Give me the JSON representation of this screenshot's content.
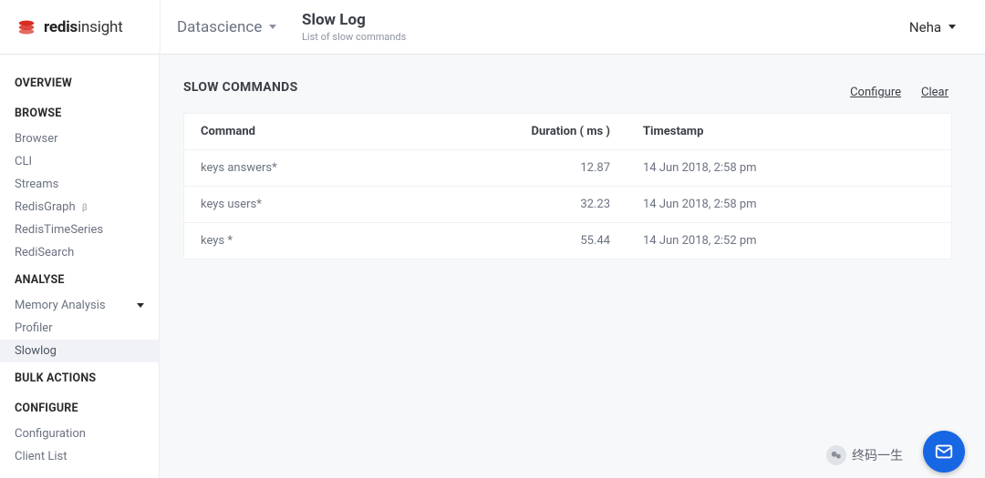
{
  "brand": {
    "bold": "redis",
    "light": "insight"
  },
  "dbSelector": {
    "name": "Datascience"
  },
  "page": {
    "title": "Slow Log",
    "subtitle": "List of slow commands"
  },
  "user": {
    "name": "Neha"
  },
  "sidebar": {
    "sections": [
      {
        "header": "OVERVIEW",
        "items": []
      },
      {
        "header": "BROWSE",
        "items": [
          {
            "label": "Browser"
          },
          {
            "label": "CLI"
          },
          {
            "label": "Streams"
          },
          {
            "label": "RedisGraph",
            "beta": "β"
          },
          {
            "label": "RedisTimeSeries"
          },
          {
            "label": "RediSearch"
          }
        ]
      },
      {
        "header": "ANALYSE",
        "items": [
          {
            "label": "Memory Analysis",
            "caret": true
          },
          {
            "label": "Profiler"
          },
          {
            "label": "Slowlog",
            "active": true
          }
        ]
      },
      {
        "header": "BULK ACTIONS",
        "items": []
      },
      {
        "header": "CONFIGURE",
        "items": [
          {
            "label": "Configuration"
          },
          {
            "label": "Client List"
          }
        ]
      }
    ]
  },
  "slowlog": {
    "sectionTitle": "SLOW COMMANDS",
    "actions": {
      "configure": "Configure",
      "clear": "Clear"
    },
    "columns": {
      "command": "Command",
      "duration": "Duration ( ms )",
      "timestamp": "Timestamp"
    },
    "rows": [
      {
        "command": "keys answers*",
        "duration": "12.87",
        "timestamp": "14 Jun 2018, 2:58 pm"
      },
      {
        "command": "keys users*",
        "duration": "32.23",
        "timestamp": "14 Jun 2018, 2:58 pm"
      },
      {
        "command": "keys *",
        "duration": "55.44",
        "timestamp": "14 Jun 2018, 2:52 pm"
      }
    ]
  },
  "footer": {
    "brandText": "终码一生"
  }
}
